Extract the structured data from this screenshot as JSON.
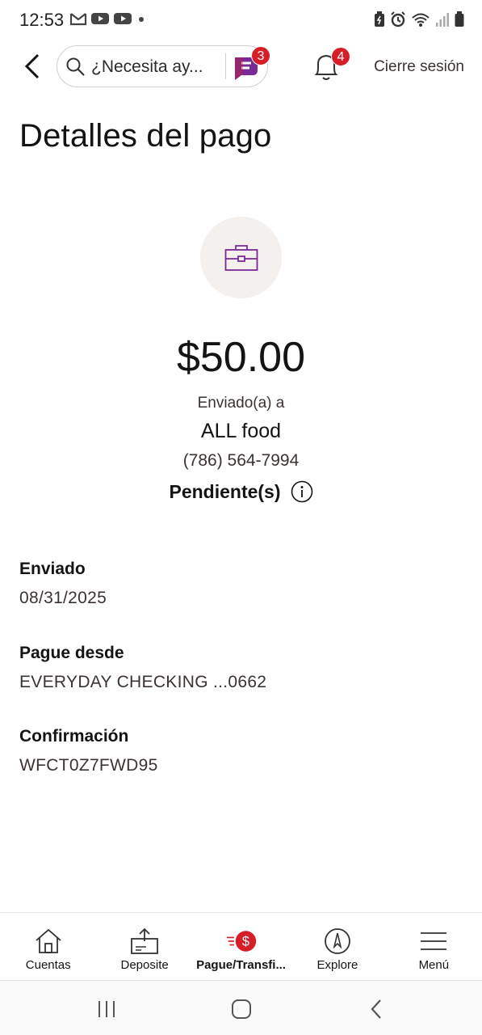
{
  "status_bar": {
    "time": "12:53"
  },
  "header": {
    "search_placeholder": "¿Necesita ay...",
    "fargo_badge": "3",
    "notifications_badge": "4",
    "logout_label": "Cierre sesión"
  },
  "page": {
    "title": "Detalles del pago"
  },
  "payment": {
    "amount": "$50.00",
    "sent_to_label": "Enviado(a) a",
    "recipient_name": "ALL food",
    "recipient_phone": "(786) 564-7994",
    "status": "Pendiente(s)"
  },
  "details": [
    {
      "label": "Enviado",
      "value": "08/31/2025"
    },
    {
      "label": "Pague desde",
      "value": "EVERYDAY CHECKING ...0662"
    },
    {
      "label": "Confirmación",
      "value": "WFCT0Z7FWD95"
    }
  ],
  "bottom_nav": {
    "items": [
      {
        "label": "Cuentas",
        "icon": "home-icon"
      },
      {
        "label": "Deposite",
        "icon": "deposit-icon"
      },
      {
        "label": "Pague/Transfi...",
        "icon": "pay-transfer-icon"
      },
      {
        "label": "Explore",
        "icon": "compass-icon"
      },
      {
        "label": "Menú",
        "icon": "menu-icon"
      }
    ]
  },
  "colors": {
    "brand_red": "#d71e28",
    "accent_purple": "#7a2a96",
    "icon_circle_bg": "#f4f0ed",
    "text_primary": "#141414",
    "text_secondary": "#3b3331"
  }
}
